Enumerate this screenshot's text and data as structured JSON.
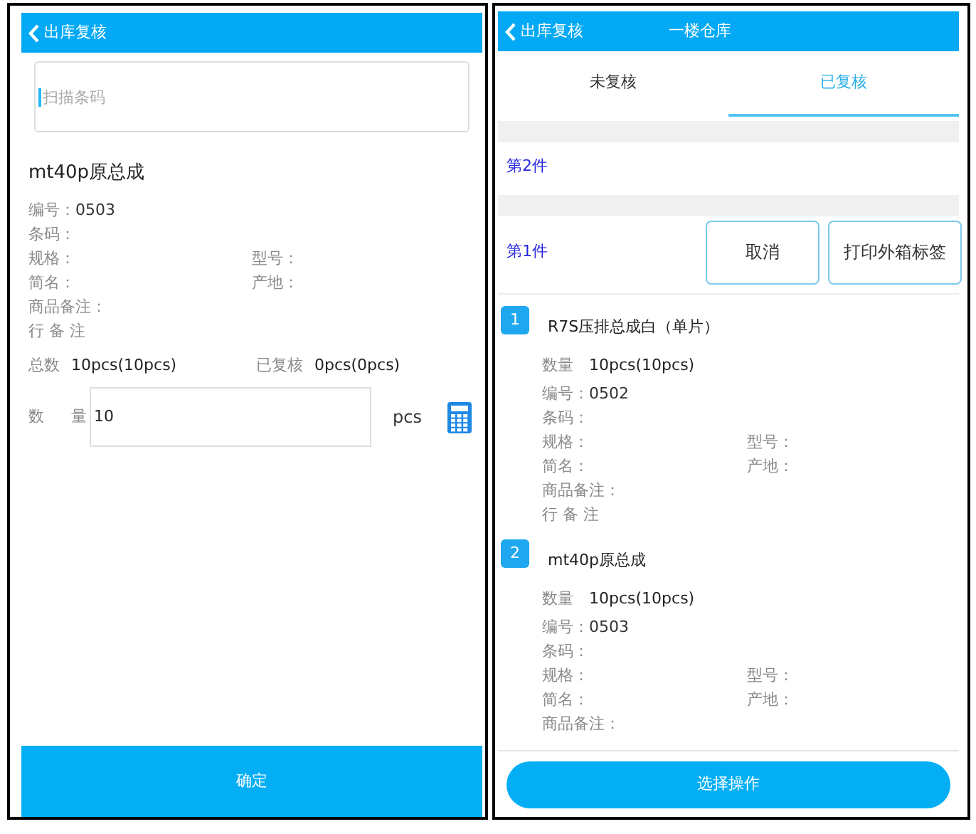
{
  "left_screen": {
    "header": {
      "title": "出库复核"
    },
    "scan_field": {
      "placeholder": "扫描条码"
    },
    "product": {
      "name": "mt40p原总成",
      "rows": [
        [
          {
            "label": "编号：",
            "value": "0503"
          }
        ],
        [
          {
            "label": "条码："
          }
        ],
        [
          {
            "label": "规格："
          },
          {
            "label": "型号："
          }
        ],
        [
          {
            "label": "简名："
          },
          {
            "label": "产地："
          }
        ],
        [
          {
            "label": "商品备注："
          }
        ],
        [
          {
            "label": "行 备 注"
          }
        ]
      ]
    },
    "totals": [
      {
        "label": "总数",
        "value": "10pcs(10pcs)"
      },
      {
        "label": "已复核",
        "value": "0pcs(0pcs)"
      }
    ],
    "quantity": {
      "label": "数",
      "label_end": "量",
      "value": "10",
      "unit": "pcs"
    },
    "confirm_button": "确定"
  },
  "right_screen": {
    "header": {
      "title": "出库复核",
      "subtitle": "一楼仓库"
    },
    "tabs": [
      {
        "label": "未复核",
        "selected": false
      },
      {
        "label": "已复核",
        "selected": true
      }
    ],
    "packages": [
      {
        "label": "第2件"
      },
      {
        "label": "第1件",
        "actions": [
          "取消",
          "打印外箱标签"
        ]
      }
    ],
    "items": [
      {
        "index": "1",
        "name": "R7S压排总成白（单片）",
        "quantity_label": "数量",
        "quantity": "10pcs(10pcs)",
        "rows": [
          [
            {
              "label": "编号：",
              "value": "0502"
            }
          ],
          [
            {
              "label": "条码："
            }
          ],
          [
            {
              "label": "规格："
            },
            {
              "label": "型号："
            }
          ],
          [
            {
              "label": "简名："
            },
            {
              "label": "产地："
            }
          ],
          [
            {
              "label": "商品备注："
            }
          ],
          [
            {
              "label": "行 备 注"
            }
          ]
        ]
      },
      {
        "index": "2",
        "name": "mt40p原总成",
        "quantity_label": "数量",
        "quantity": "10pcs(10pcs)",
        "rows": [
          [
            {
              "label": "编号：",
              "value": "0503"
            }
          ],
          [
            {
              "label": "条码："
            }
          ],
          [
            {
              "label": "规格："
            },
            {
              "label": "型号："
            }
          ],
          [
            {
              "label": "简名："
            },
            {
              "label": "产地："
            }
          ],
          [
            {
              "label": "商品备注："
            }
          ]
        ]
      }
    ],
    "action_button": "选择操作"
  }
}
